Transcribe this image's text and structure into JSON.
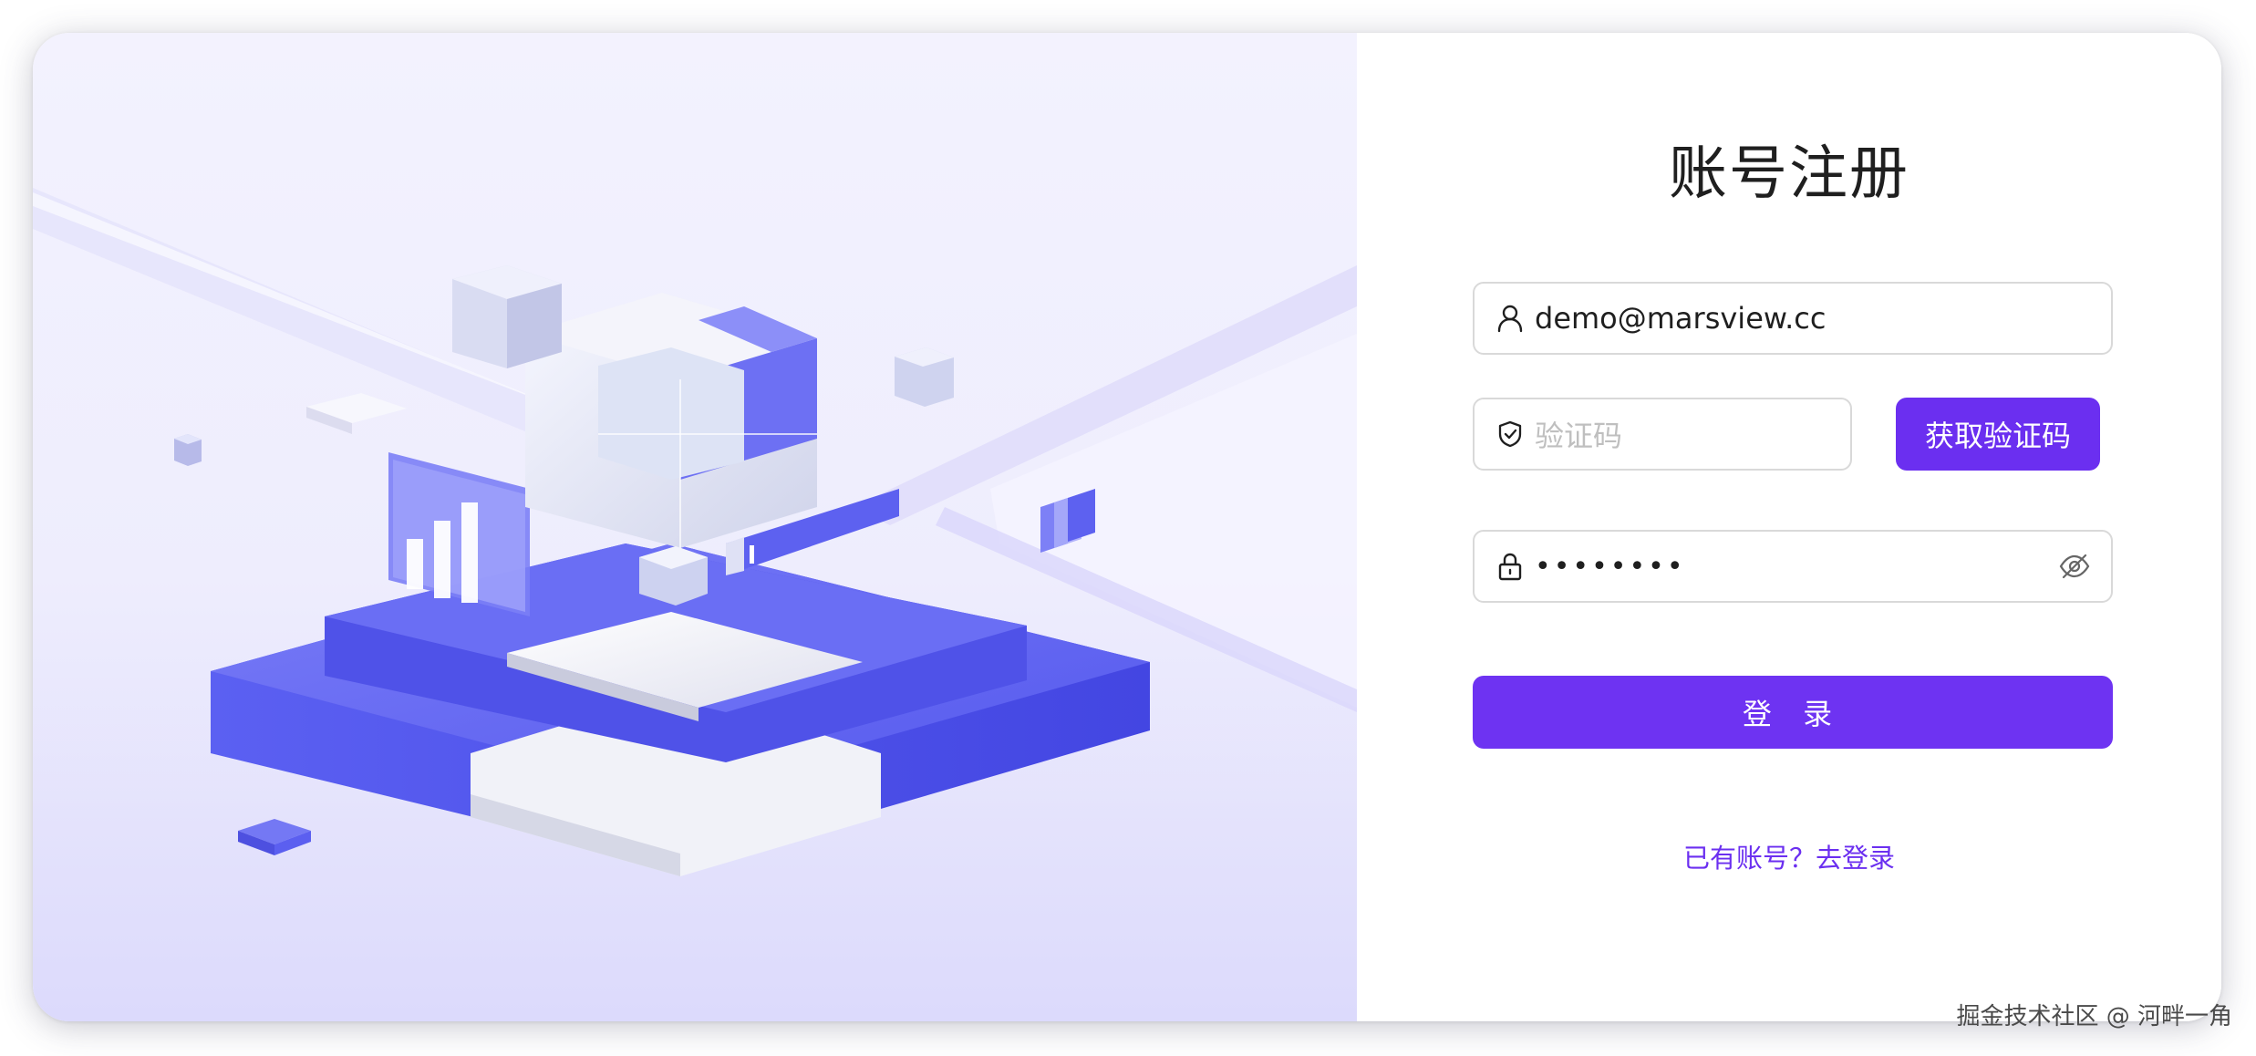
{
  "page": {
    "title": "账号注册"
  },
  "form": {
    "email": {
      "icon": "user-icon",
      "value": "demo@marsview.cc"
    },
    "code": {
      "icon": "shield-check-icon",
      "placeholder": "验证码",
      "button_label": "获取验证码"
    },
    "password": {
      "icon": "lock-icon",
      "masked_value": "••••••••",
      "toggle_icon": "eye-invisible-icon"
    },
    "submit_label": "登 录",
    "login_link": "已有账号？去登录"
  },
  "watermark": "掘金技术社区 @ 河畔一角",
  "colors": {
    "primary": "#6b2ff0",
    "illustration_accent": "#5b5ff0",
    "illustration_background": "#eceafd"
  }
}
